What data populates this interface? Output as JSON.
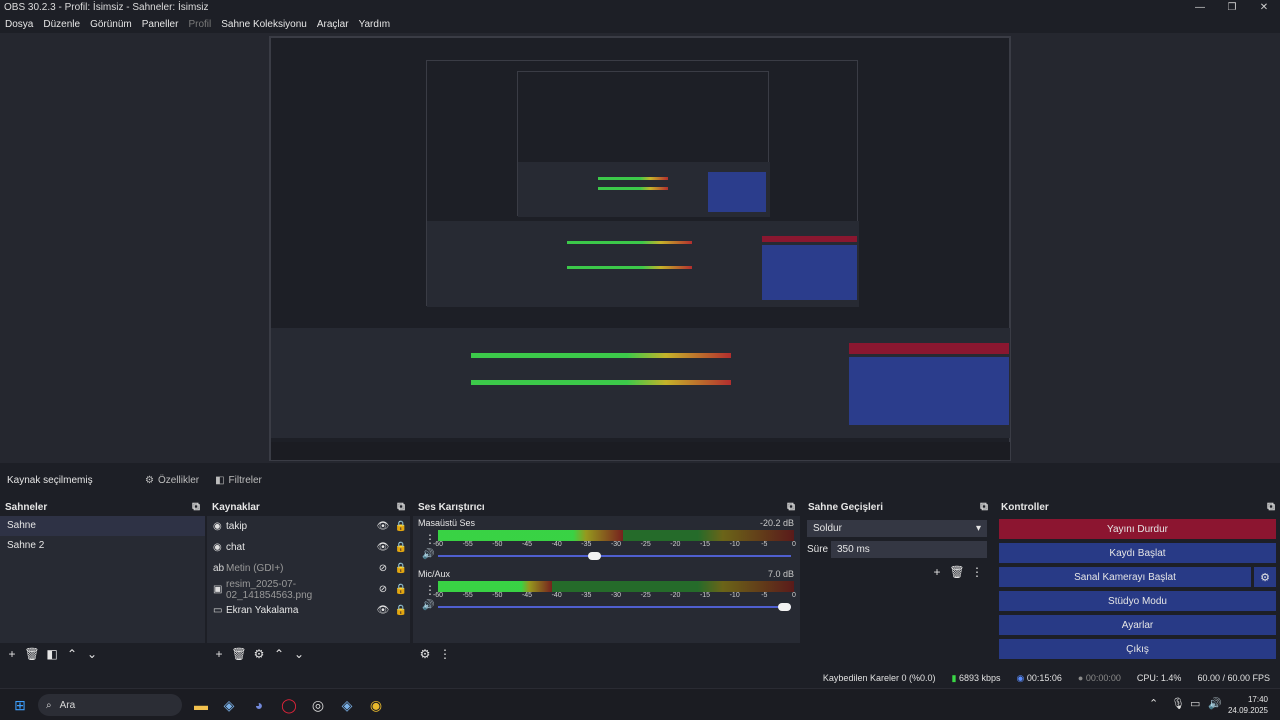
{
  "window": {
    "title": "OBS 30.2.3 - Profil: İsimsiz - Sahneler: İsimsiz",
    "minimize": "—",
    "maximize": "❐",
    "close": "✕"
  },
  "menu": [
    "Dosya",
    "Düzenle",
    "Görünüm",
    "Paneller",
    "Profil",
    "Sahne Koleksiyonu",
    "Araçlar",
    "Yardım"
  ],
  "sourcebar": {
    "none_selected": "Kaynak seçilmemiş",
    "properties": "Özellikler",
    "filters": "Filtreler"
  },
  "scenes": {
    "title": "Sahneler",
    "items": [
      "Sahne",
      "Sahne 2"
    ]
  },
  "sources": {
    "title": "Kaynaklar",
    "items": [
      {
        "name": "takip",
        "icon": "browser-icon"
      },
      {
        "name": "chat",
        "icon": "browser-icon"
      },
      {
        "name": "Metin (GDI+)",
        "icon": "text-icon"
      },
      {
        "name": "resim_2025-07-02_141854563.png",
        "icon": "image-icon"
      },
      {
        "name": "Ekran Yakalama",
        "icon": "monitor-icon"
      }
    ]
  },
  "mixer": {
    "title": "Ses Karıştırıcı",
    "ticks": [
      "-60",
      "-55",
      "-50",
      "-45",
      "-40",
      "-35",
      "-30",
      "-25",
      "-20",
      "-15",
      "-10",
      "-5",
      "0"
    ],
    "channels": [
      {
        "name": "Masaüstü Ses",
        "db": "-20.2 dB",
        "level": 0.52,
        "volume": 0.44
      },
      {
        "name": "Mic/Aux",
        "db": "7.0 dB",
        "level": 0.32,
        "volume": 1.0
      }
    ]
  },
  "transitions": {
    "title": "Sahne Geçişleri",
    "selected": "Soldur",
    "duration_label": "Süre",
    "duration_value": "350 ms"
  },
  "controls": {
    "title": "Kontroller",
    "stop_stream": "Yayını Durdur",
    "start_record": "Kaydı Başlat",
    "start_virtualcam": "Sanal Kamerayı Başlat",
    "studio_mode": "Stüdyo Modu",
    "settings": "Ayarlar",
    "exit": "Çıkış"
  },
  "status": {
    "dropped": "Kaybedilen Kareler 0 (%0.0)",
    "bitrate": "6893 kbps",
    "stream_time": "00:15:06",
    "rec_time": "00:00:00",
    "cpu": "CPU: 1.4%",
    "fps": "60.00 / 60.00 FPS"
  },
  "taskbar": {
    "search_placeholder": "Ara",
    "time": "17:40",
    "date": "24.09.2025"
  },
  "colors": {
    "red_button": "#8c1530",
    "blue_button": "#283a86",
    "meter_green": "#3ad846"
  }
}
